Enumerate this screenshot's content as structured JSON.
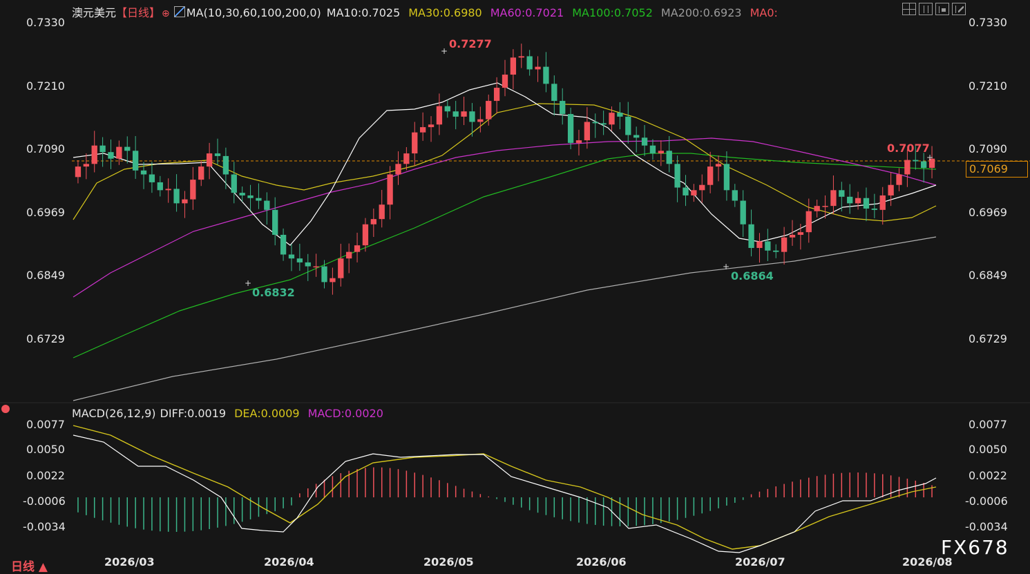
{
  "header": {
    "symbol": "澳元美元",
    "period": "【日线】",
    "ma_label": "MA(10,30,60,100,200,0)",
    "ma10": "MA10:0.7025",
    "ma30": "MA30:0.6980",
    "ma60": "MA60:0.7021",
    "ma100": "MA100:0.7052",
    "ma200": "MA200:0.6923",
    "ma0": "MA0:"
  },
  "price_axis": [
    "0.7330",
    "0.7210",
    "0.7090",
    "0.6969",
    "0.6849",
    "0.6729"
  ],
  "current_price": "0.7069",
  "annotations": {
    "high": "0.7277",
    "low1": "0.6832",
    "low2": "0.6864",
    "recent_high": "0.7077"
  },
  "macd_header": {
    "label": "MACD(26,12,9)",
    "diff": "DIFF:0.0019",
    "dea": "DEA:0.0009",
    "macd": "MACD:0.0020"
  },
  "macd_axis": [
    "0.0077",
    "0.0050",
    "0.0022",
    "-0.0006",
    "-0.0034"
  ],
  "dates": [
    "2026/03",
    "2026/04",
    "2026/05",
    "2026/06",
    "2026/07",
    "2026/08"
  ],
  "footer": {
    "period_button": "日线 ▲",
    "watermark": "FX678"
  },
  "toolbar": [
    "grid-icon",
    "split-icon",
    "chart-icon",
    "layout-icon"
  ],
  "colors": {
    "up": "#f0525a",
    "down": "#3bb78b",
    "ma10": "#ffffff",
    "ma30": "#d6c61c",
    "ma60": "#cc33cc",
    "ma100": "#22aa22",
    "ma200": "#999999"
  },
  "chart_data": {
    "type": "candlestick",
    "series_summary": "AUDUSD daily",
    "y_range": [
      0.6729,
      0.733
    ],
    "candles_close": [
      0.7055,
      0.7095,
      0.707,
      0.7085,
      0.704,
      0.701,
      0.6985,
      0.703,
      0.708,
      0.704,
      0.7,
      0.699,
      0.6925,
      0.688,
      0.6865,
      0.6835,
      0.688,
      0.6905,
      0.6955,
      0.704,
      0.708,
      0.713,
      0.717,
      0.715,
      0.714,
      0.718,
      0.723,
      0.7265,
      0.7245,
      0.718,
      0.71,
      0.714,
      0.7135,
      0.715,
      0.711,
      0.708,
      0.706,
      0.7,
      0.702,
      0.706,
      0.699,
      0.69,
      0.6895,
      0.692,
      0.693,
      0.698,
      0.701,
      0.6985,
      0.6975,
      0.7,
      0.704,
      0.7065,
      0.707
    ]
  }
}
